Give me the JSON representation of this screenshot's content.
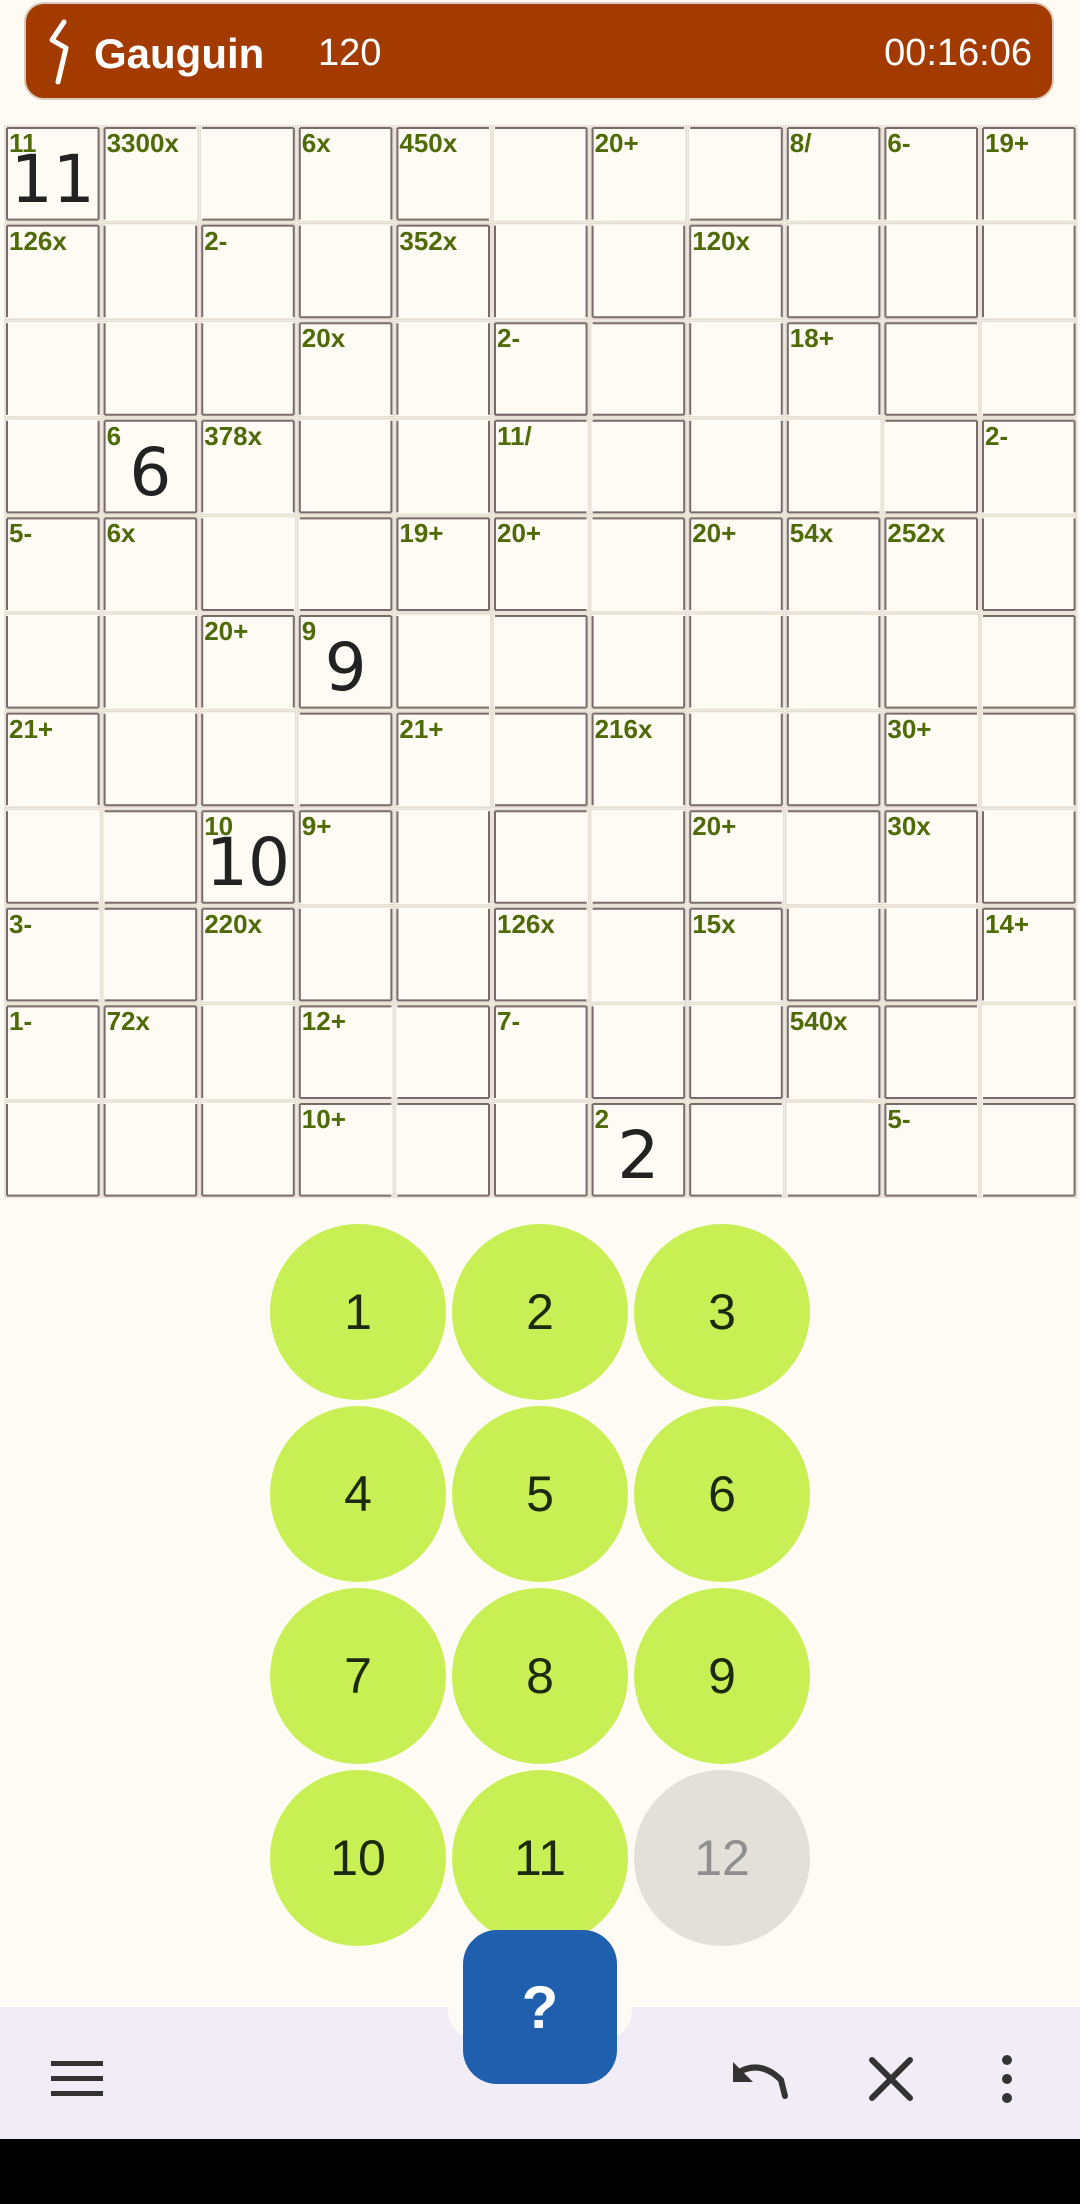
{
  "header": {
    "title": "Gauguin",
    "score": "120",
    "timer": "00:16:06"
  },
  "grid": {
    "size": 11,
    "cells": [
      {
        "r": 0,
        "c": 0,
        "clue": "11",
        "value": "11"
      },
      {
        "r": 0,
        "c": 1,
        "clue": "3300x",
        "value": ""
      },
      {
        "r": 0,
        "c": 3,
        "clue": "6x",
        "value": ""
      },
      {
        "r": 0,
        "c": 4,
        "clue": "450x",
        "value": ""
      },
      {
        "r": 0,
        "c": 6,
        "clue": "20+",
        "value": ""
      },
      {
        "r": 0,
        "c": 8,
        "clue": "8/",
        "value": ""
      },
      {
        "r": 0,
        "c": 9,
        "clue": "6-",
        "value": ""
      },
      {
        "r": 0,
        "c": 10,
        "clue": "19+",
        "value": ""
      },
      {
        "r": 1,
        "c": 0,
        "clue": "126x",
        "value": ""
      },
      {
        "r": 1,
        "c": 2,
        "clue": "2-",
        "value": ""
      },
      {
        "r": 1,
        "c": 4,
        "clue": "352x",
        "value": ""
      },
      {
        "r": 1,
        "c": 7,
        "clue": "120x",
        "value": ""
      },
      {
        "r": 2,
        "c": 3,
        "clue": "20x",
        "value": ""
      },
      {
        "r": 2,
        "c": 5,
        "clue": "2-",
        "value": ""
      },
      {
        "r": 2,
        "c": 8,
        "clue": "18+",
        "value": ""
      },
      {
        "r": 3,
        "c": 1,
        "clue": "6",
        "value": "6"
      },
      {
        "r": 3,
        "c": 2,
        "clue": "378x",
        "value": ""
      },
      {
        "r": 3,
        "c": 5,
        "clue": "11/",
        "value": ""
      },
      {
        "r": 3,
        "c": 10,
        "clue": "2-",
        "value": ""
      },
      {
        "r": 4,
        "c": 0,
        "clue": "5-",
        "value": ""
      },
      {
        "r": 4,
        "c": 1,
        "clue": "6x",
        "value": ""
      },
      {
        "r": 4,
        "c": 4,
        "clue": "19+",
        "value": ""
      },
      {
        "r": 4,
        "c": 5,
        "clue": "20+",
        "value": ""
      },
      {
        "r": 4,
        "c": 7,
        "clue": "20+",
        "value": ""
      },
      {
        "r": 4,
        "c": 8,
        "clue": "54x",
        "value": ""
      },
      {
        "r": 4,
        "c": 9,
        "clue": "252x",
        "value": ""
      },
      {
        "r": 5,
        "c": 2,
        "clue": "20+",
        "value": ""
      },
      {
        "r": 5,
        "c": 3,
        "clue": "9",
        "value": "9"
      },
      {
        "r": 6,
        "c": 0,
        "clue": "21+",
        "value": ""
      },
      {
        "r": 6,
        "c": 4,
        "clue": "21+",
        "value": ""
      },
      {
        "r": 6,
        "c": 6,
        "clue": "216x",
        "value": ""
      },
      {
        "r": 6,
        "c": 9,
        "clue": "30+",
        "value": ""
      },
      {
        "r": 7,
        "c": 2,
        "clue": "10",
        "value": "10"
      },
      {
        "r": 7,
        "c": 3,
        "clue": "9+",
        "value": ""
      },
      {
        "r": 7,
        "c": 7,
        "clue": "20+",
        "value": ""
      },
      {
        "r": 7,
        "c": 9,
        "clue": "30x",
        "value": ""
      },
      {
        "r": 8,
        "c": 0,
        "clue": "3-",
        "value": ""
      },
      {
        "r": 8,
        "c": 2,
        "clue": "220x",
        "value": ""
      },
      {
        "r": 8,
        "c": 5,
        "clue": "126x",
        "value": ""
      },
      {
        "r": 8,
        "c": 7,
        "clue": "15x",
        "value": ""
      },
      {
        "r": 8,
        "c": 10,
        "clue": "14+",
        "value": ""
      },
      {
        "r": 9,
        "c": 0,
        "clue": "1-",
        "value": ""
      },
      {
        "r": 9,
        "c": 1,
        "clue": "72x",
        "value": ""
      },
      {
        "r": 9,
        "c": 3,
        "clue": "12+",
        "value": ""
      },
      {
        "r": 9,
        "c": 5,
        "clue": "7-",
        "value": ""
      },
      {
        "r": 9,
        "c": 8,
        "clue": "540x",
        "value": ""
      },
      {
        "r": 10,
        "c": 3,
        "clue": "10+",
        "value": ""
      },
      {
        "r": 10,
        "c": 6,
        "clue": "2",
        "value": "2"
      },
      {
        "r": 10,
        "c": 9,
        "clue": "5-",
        "value": ""
      }
    ]
  },
  "keypad": [
    {
      "label": "1",
      "enabled": true
    },
    {
      "label": "2",
      "enabled": true
    },
    {
      "label": "3",
      "enabled": true
    },
    {
      "label": "4",
      "enabled": true
    },
    {
      "label": "5",
      "enabled": true
    },
    {
      "label": "6",
      "enabled": true
    },
    {
      "label": "7",
      "enabled": true
    },
    {
      "label": "8",
      "enabled": true
    },
    {
      "label": "9",
      "enabled": true
    },
    {
      "label": "10",
      "enabled": true
    },
    {
      "label": "11",
      "enabled": true
    },
    {
      "label": "12",
      "enabled": false
    }
  ],
  "help_button": {
    "label": "?"
  },
  "bottom_bar": {
    "icons": [
      "menu-icon",
      "undo-icon",
      "clear-icon",
      "more-vert-icon"
    ]
  },
  "colors": {
    "header_bg": "#a33a00",
    "clue_text": "#4f6a08",
    "keypad_bg": "#c8f054",
    "keypad_disabled_bg": "#e3e0d9",
    "help_bg": "#1f5fae"
  }
}
